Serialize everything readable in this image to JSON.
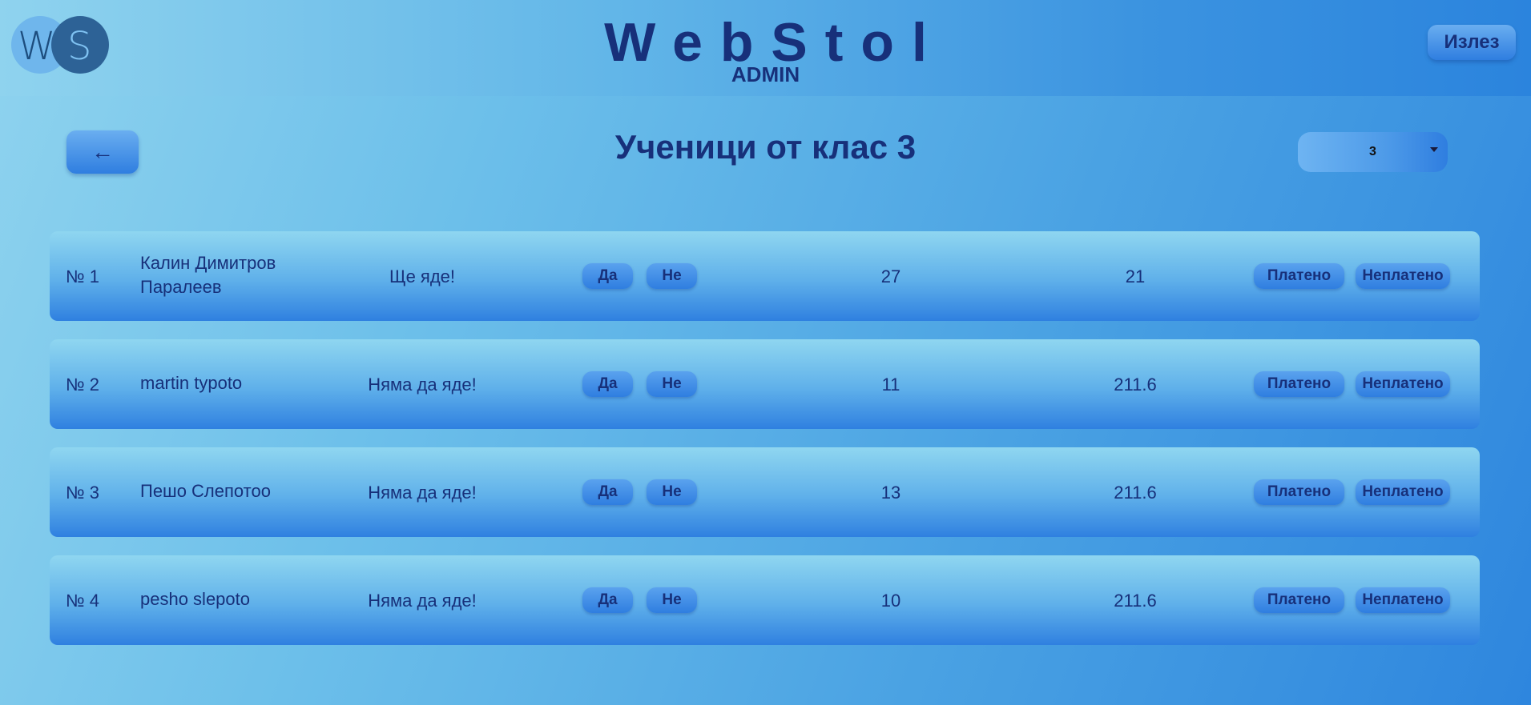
{
  "header": {
    "logo_w": "W",
    "logo_s": "S",
    "brand": "WebStol",
    "subtitle": "ADMIN",
    "logout_label": "Излез"
  },
  "page": {
    "back_icon": "←",
    "title": "Ученици от клас 3",
    "class_select": {
      "selected": "3"
    }
  },
  "students": [
    {
      "num": "№ 1",
      "name": "Калин Димитров Паралеев",
      "status": "Ще яде!",
      "yes": "Да",
      "no": "Не",
      "val1": "27",
      "val2": "21",
      "paid": "Платено",
      "unpaid": "Неплатено"
    },
    {
      "num": "№ 2",
      "name": "martin typoto",
      "status": "Няма да яде!",
      "yes": "Да",
      "no": "Не",
      "val1": "11",
      "val2": "211.6",
      "paid": "Платено",
      "unpaid": "Неплатено"
    },
    {
      "num": "№ 3",
      "name": "Пешо Слепотоо",
      "status": "Няма да яде!",
      "yes": "Да",
      "no": "Не",
      "val1": "13",
      "val2": "211.6",
      "paid": "Платено",
      "unpaid": "Неплатено"
    },
    {
      "num": "№ 4",
      "name": "pesho slepoto",
      "status": "Няма да яде!",
      "yes": "Да",
      "no": "Не",
      "val1": "10",
      "val2": "211.6",
      "paid": "Платено",
      "unpaid": "Неплатено"
    }
  ]
}
